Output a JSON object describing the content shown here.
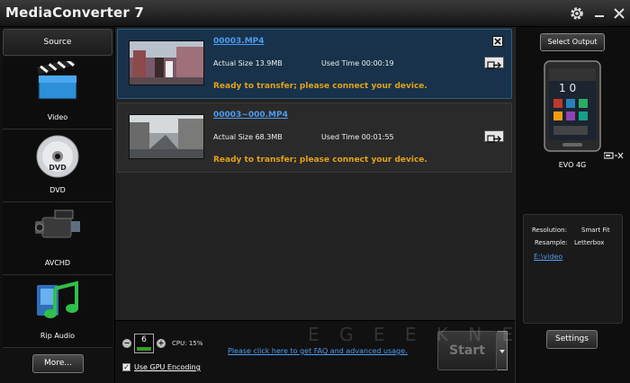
{
  "app": {
    "title": "MediaConverter 7"
  },
  "sidebar": {
    "header": "Source",
    "items": [
      {
        "label": "Video",
        "icon": "clapperboard-icon"
      },
      {
        "label": "DVD",
        "icon": "dvd-disc-icon"
      },
      {
        "label": "AVCHD",
        "icon": "camcorder-icon"
      },
      {
        "label": "Rip Audio",
        "icon": "music-note-icon"
      }
    ],
    "more_label": "More..."
  },
  "tasks": [
    {
      "filename": "00003.MP4",
      "size_label": "Actual Size 13.9MB",
      "time_label": "Used Time 00:00:19",
      "status": "Ready to transfer; please connect your device.",
      "selected": true
    },
    {
      "filename": "00003~000.MP4",
      "size_label": "Actual Size 68.3MB",
      "time_label": "Used Time 00:01:55",
      "status": "Ready to transfer; please connect your device.",
      "selected": false
    }
  ],
  "bottom": {
    "cores": "6",
    "cpu_label": "CPU: 15%",
    "gpu_label": "Use GPU Encoding",
    "gpu_checked": true,
    "faq_link": "Please click here to get FAQ and advanced usage.",
    "start_label": "Start",
    "minus": "−",
    "plus": "+"
  },
  "watermark": "E G E E K N E T C",
  "output": {
    "select_label": "Select Output",
    "device_name": "EVO 4G",
    "resolution_label": "Resolution:",
    "resolution_value": "Smart Fit",
    "resample_label": "Resample:",
    "resample_value": "Letterbox",
    "path": "E:\\video",
    "settings_label": "Settings"
  },
  "colors": {
    "accent_link": "#4f9cf0",
    "status_text": "#e3a21a",
    "selected_row": "#17324a"
  }
}
